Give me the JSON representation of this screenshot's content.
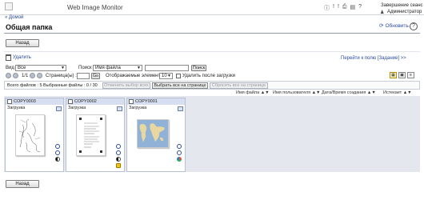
{
  "header": {
    "app_title": "Web Image Monitor",
    "logout_label": "Завершение сеанс",
    "admin_label": "Администратор",
    "home_link": "« Домой"
  },
  "page": {
    "title": "Общая папка",
    "refresh_label": "Обновить",
    "back_label": "Назад"
  },
  "controls": {
    "delete_label": "Удалить",
    "goto_link": "Перейти к полю [Задание] >>",
    "view_label": "Вид :",
    "view_value": "Все",
    "search_label": "Поиск :",
    "search_field_value": "Имя файла",
    "search_button": "Поиск",
    "pager_text": "1/1",
    "page_label": "Страница(ы) :",
    "go_button": "Go",
    "display_label": "Отображаемые элементы :",
    "display_value": "10",
    "delete_after_label": "Удалить после загрузки"
  },
  "toolbar": {
    "totals": "Всего файлов : 5  Выбранные файлы : 0  / 30",
    "cancel_select": "Отменить выбор всех",
    "select_all_page": "Выбрать все на странице",
    "reset_page": "Сбросить все на странице"
  },
  "sort": {
    "file_name": "Имя файла ▲▼",
    "user_name": "Имя пользователя ▲▼",
    "date": "Дата/Время создания ▲▼",
    "expires": "Истекает ▲▼"
  },
  "cards": [
    {
      "name": "COPY0003",
      "status": "Загрузка"
    },
    {
      "name": "COPY0002",
      "status": "Загрузка"
    },
    {
      "name": "COPY0001",
      "status": "Загрузка"
    }
  ]
}
